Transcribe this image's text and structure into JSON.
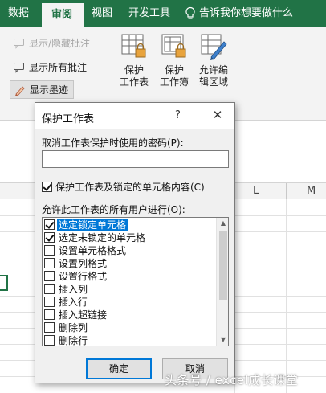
{
  "colors": {
    "excel_green": "#217346",
    "focus_blue": "#0078d7"
  },
  "ribbon_tabs": [
    {
      "label": "数据"
    },
    {
      "label": "审阅",
      "active": true
    },
    {
      "label": "视图"
    },
    {
      "label": "开发工具"
    },
    {
      "label": "告诉我你想要做什么",
      "icon": "lightbulb-icon"
    }
  ],
  "ribbon": {
    "comments": {
      "show_hide_comment": "显示/隐藏批注",
      "show_all_comments": "显示所有批注",
      "show_ink": "显示墨迹"
    },
    "protect": {
      "protect_sheet": [
        "保护",
        "工作表"
      ],
      "protect_workbook": [
        "保护",
        "工作簿"
      ],
      "allow_edit_ranges": [
        "允许编",
        "辑区域"
      ]
    }
  },
  "sheet": {
    "column_headers": [
      "L",
      "M"
    ]
  },
  "dialog": {
    "title": "保护工作表",
    "help": "?",
    "close": "✕",
    "password_label": "取消工作表保护时使用的密码(P):",
    "password_value": "",
    "protect_checkbox_label": "保护工作表及锁定的单元格内容(C)",
    "protect_checked": true,
    "allow_label": "允许此工作表的所有用户进行(O):",
    "permissions": [
      {
        "label": "选定锁定单元格",
        "checked": true
      },
      {
        "label": "选定未锁定的单元格",
        "checked": true
      },
      {
        "label": "设置单元格格式",
        "checked": false
      },
      {
        "label": "设置列格式",
        "checked": false
      },
      {
        "label": "设置行格式",
        "checked": false
      },
      {
        "label": "插入列",
        "checked": false
      },
      {
        "label": "插入行",
        "checked": false
      },
      {
        "label": "插入超链接",
        "checked": false
      },
      {
        "label": "删除列",
        "checked": false
      },
      {
        "label": "删除行",
        "checked": false
      }
    ],
    "ok_label": "确定",
    "cancel_label": "取消"
  },
  "watermark": "头条号 / excel成长课堂"
}
